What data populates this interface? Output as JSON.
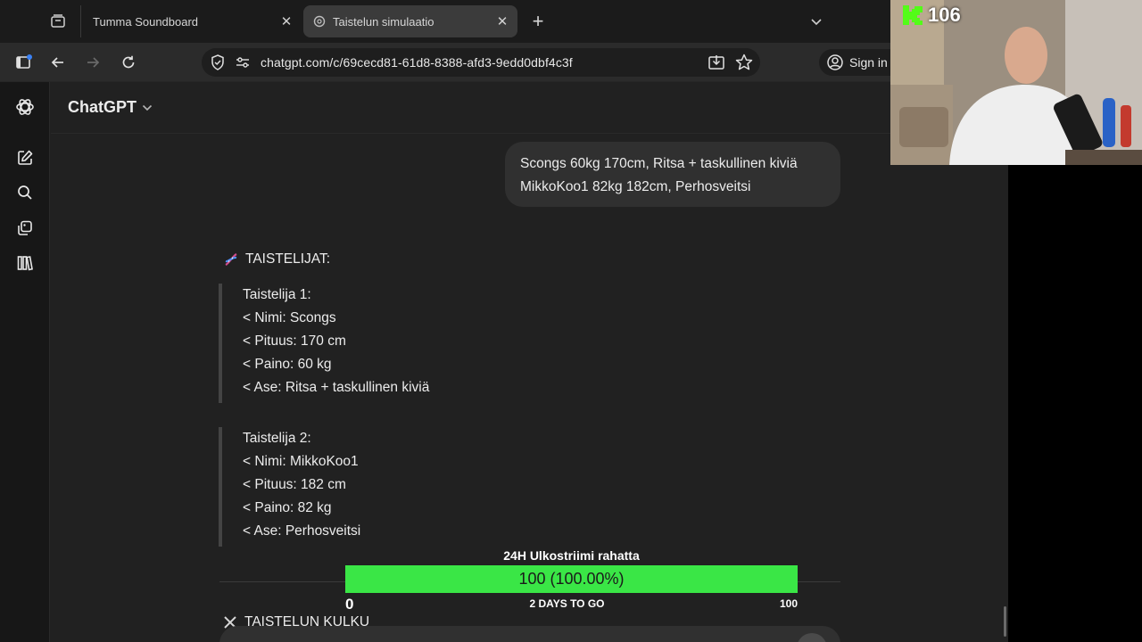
{
  "browser": {
    "tabs": [
      {
        "label": "Tumma Soundboard",
        "active": false
      },
      {
        "label": "Taistelun simulaatio",
        "active": true
      }
    ],
    "url": "chatgpt.com/c/69cecd81-61d8-8388-afd3-9edd0dbf4c3f",
    "sign_in_label": "Sign in"
  },
  "app": {
    "model_label": "ChatGPT",
    "sidebar_icons": [
      "openai-logo-icon",
      "new-chat-icon",
      "search-icon",
      "library-icon",
      "codex-icon"
    ]
  },
  "conversation": {
    "user_message": [
      "Scongs 60kg 170cm, Ritsa + taskullinen kiviä",
      "MikkoKoo1 82kg 182cm, Perhosveitsi"
    ],
    "assistant": {
      "heading": "TAISTELIJAT:",
      "fighter1": [
        "Taistelija 1:",
        "< Nimi: Scongs",
        "< Pituus: 170 cm",
        "< Paino: 60 kg",
        "< Ase: Ritsa + taskullinen kiviä"
      ],
      "fighter2": [
        "Taistelija 2:",
        "< Nimi: MikkoKoo1",
        "< Pituus: 182 cm",
        "< Paino: 82 kg",
        "< Ase: Perhosveitsi"
      ],
      "next_heading": "TAISTELUN KULKU"
    }
  },
  "overlay": {
    "follower_count": "106",
    "goal": {
      "title": "24H Ulkostriimi rahatta",
      "progress_text": "100 (100.00%)",
      "progress_fraction": 1.0,
      "min_label": "0",
      "mid_label": "2 DAYS TO GO",
      "max_label": "100",
      "fill_color": "#3ae646"
    }
  }
}
